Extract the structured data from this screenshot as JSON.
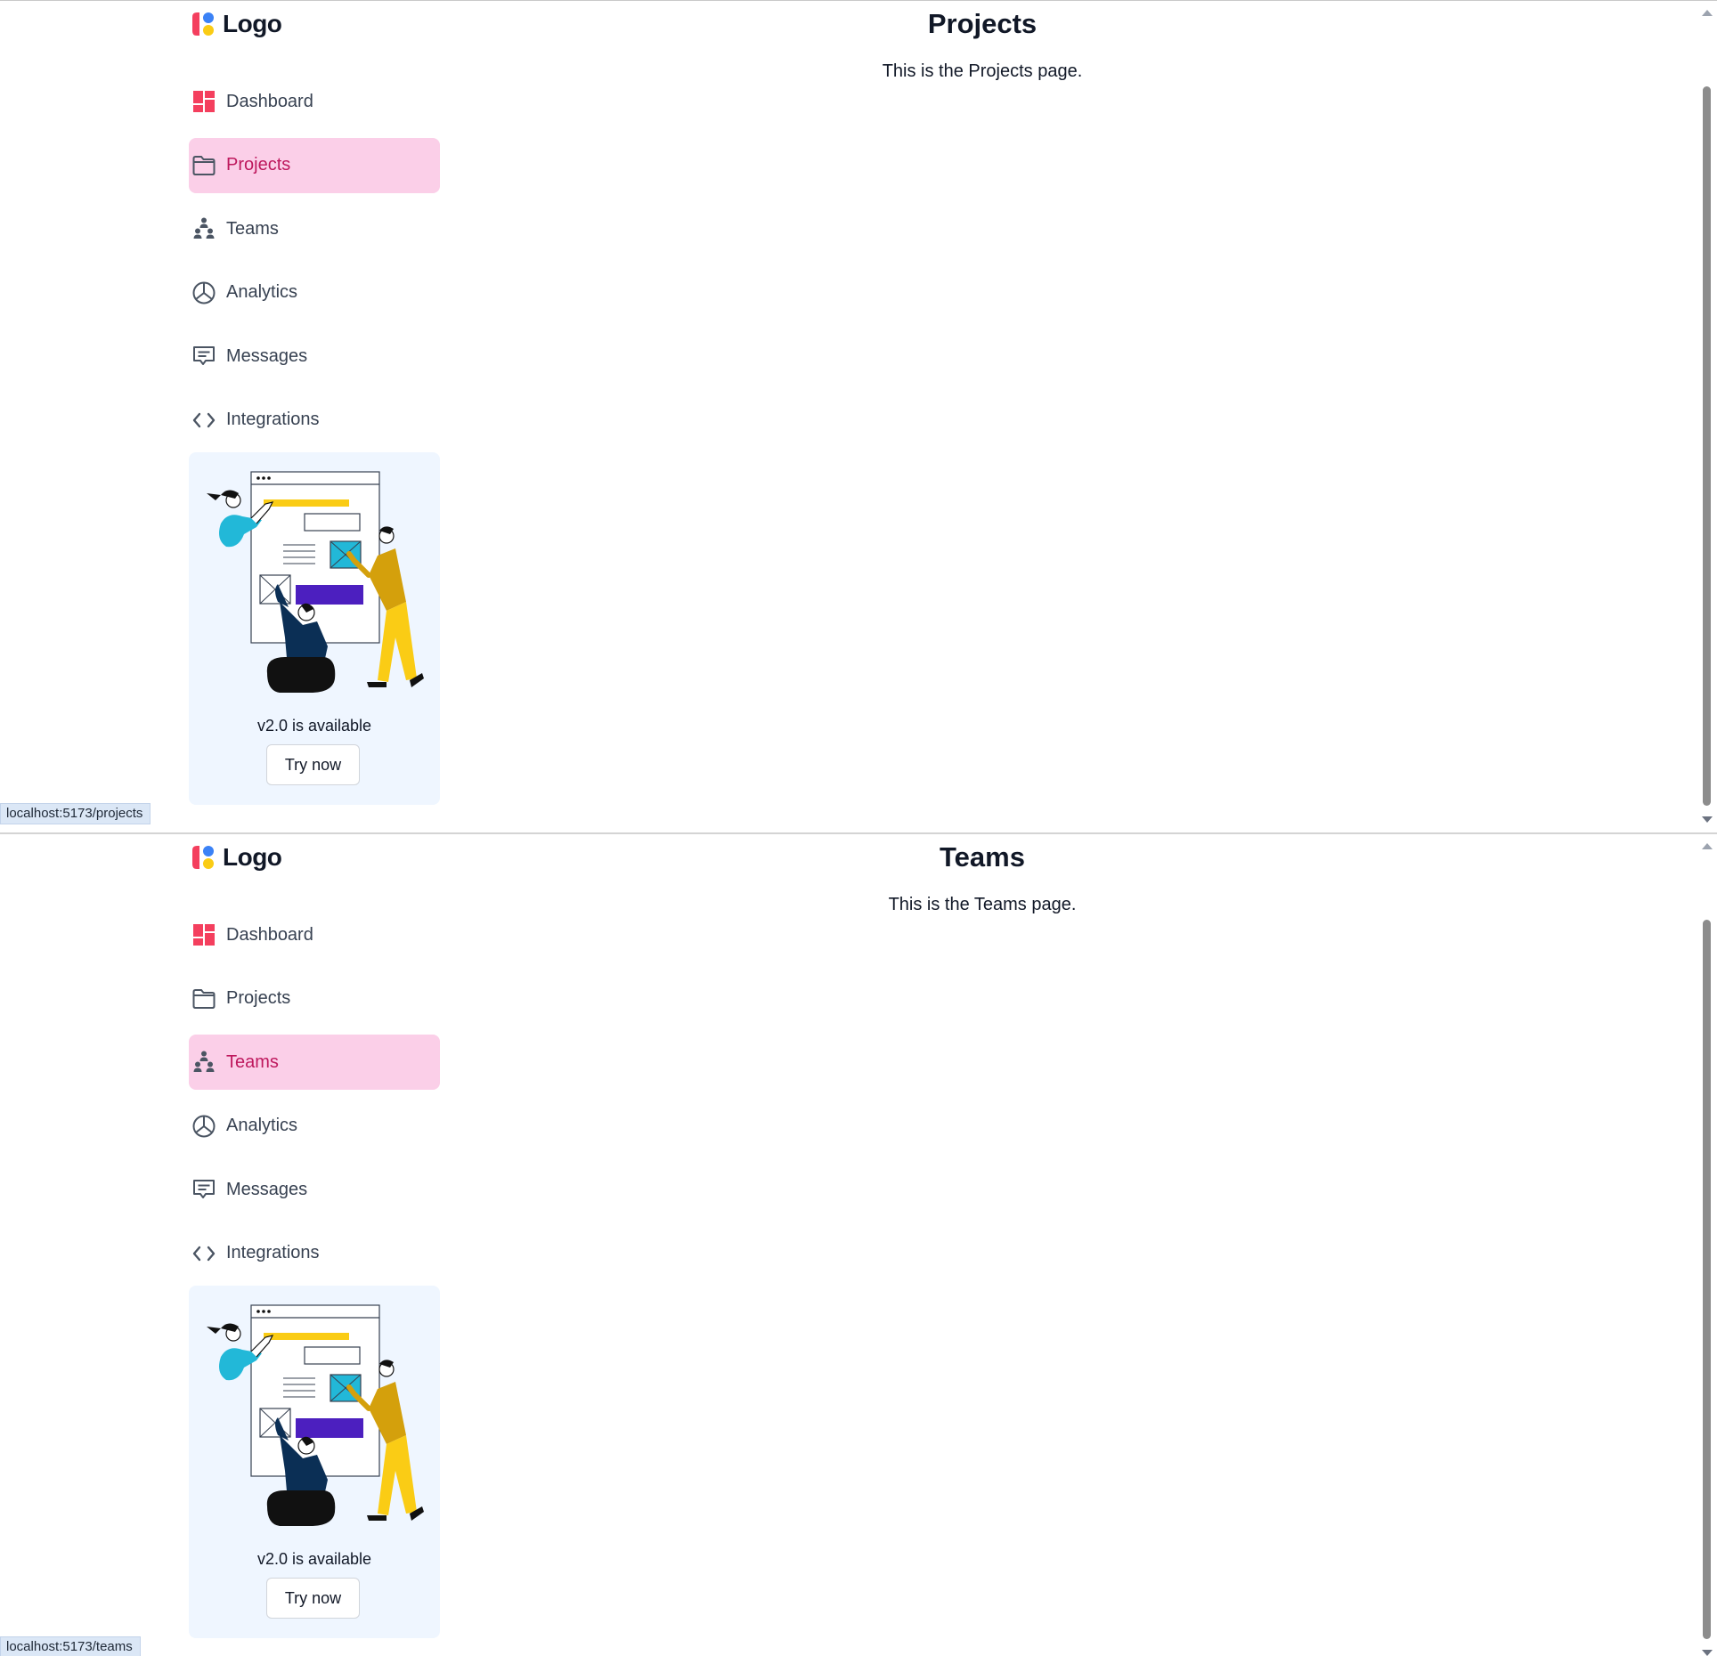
{
  "panes": [
    {
      "brand": {
        "name": "Logo"
      },
      "nav": [
        {
          "label": "Dashboard",
          "icon": "dashboard-icon",
          "active": false
        },
        {
          "label": "Projects",
          "icon": "folder-icon",
          "active": true
        },
        {
          "label": "Teams",
          "icon": "teams-icon",
          "active": false
        },
        {
          "label": "Analytics",
          "icon": "pie-chart-icon",
          "active": false
        },
        {
          "label": "Messages",
          "icon": "message-icon",
          "active": false
        },
        {
          "label": "Integrations",
          "icon": "code-icon",
          "active": false
        }
      ],
      "promo": {
        "text": "v2.0 is available",
        "button": "Try now"
      },
      "page": {
        "title": "Projects",
        "description": "This is the Projects page."
      },
      "status_url": "localhost:5173/projects"
    },
    {
      "brand": {
        "name": "Logo"
      },
      "nav": [
        {
          "label": "Dashboard",
          "icon": "dashboard-icon",
          "active": false
        },
        {
          "label": "Projects",
          "icon": "folder-icon",
          "active": false
        },
        {
          "label": "Teams",
          "icon": "teams-icon",
          "active": true
        },
        {
          "label": "Analytics",
          "icon": "pie-chart-icon",
          "active": false
        },
        {
          "label": "Messages",
          "icon": "message-icon",
          "active": false
        },
        {
          "label": "Integrations",
          "icon": "code-icon",
          "active": false
        }
      ],
      "promo": {
        "text": "v2.0 is available",
        "button": "Try now"
      },
      "page": {
        "title": "Teams",
        "description": "This is the Teams page."
      },
      "status_url": "localhost:5173/teams"
    }
  ],
  "colors": {
    "active_bg": "#fbcfe8",
    "active_text": "#be185d",
    "promo_bg": "#eff6ff",
    "brand_pink": "#f43f5e",
    "brand_blue": "#3b82f6",
    "brand_yellow": "#facc15"
  }
}
